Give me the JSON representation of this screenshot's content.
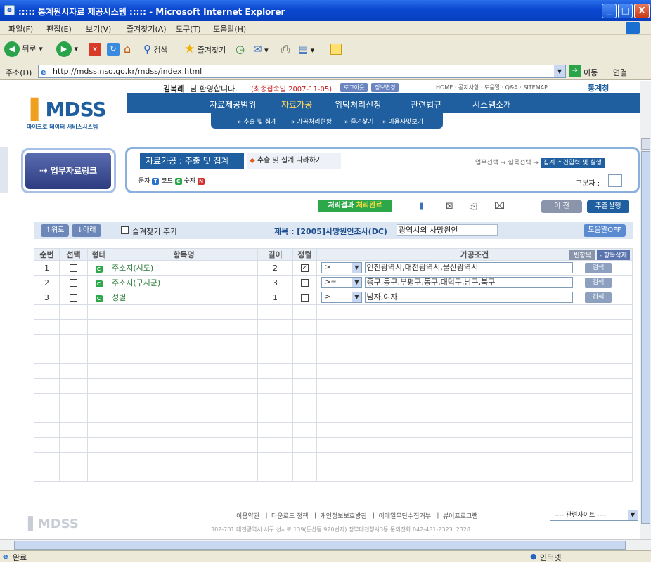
{
  "window": {
    "title": "::::: 통계원시자료 제공시스템 ::::: - Microsoft Internet Explorer",
    "min": "_",
    "max": "□",
    "close": "X"
  },
  "menu": [
    "파일(F)",
    "편집(E)",
    "보기(V)",
    "즐겨찾기(A)",
    "도구(T)",
    "도움말(H)"
  ],
  "toolbar": {
    "back": "뒤로",
    "search": "검색",
    "favorites": "즐겨찾기"
  },
  "address": {
    "label": "주소(D)",
    "url": "http://mdss.nso.go.kr/mdss/index.html",
    "go": "이동",
    "links": "연결"
  },
  "header": {
    "welcome_name": "김복례",
    "welcome_suffix": "님 환영합니다.",
    "last_login": "(최종접속일 2007-11-05)",
    "logout": "로그아웃",
    "info_change": "정보변경",
    "toplinks": "HOME · 공지사항 · 도움말 · Q&A · SITEMAP",
    "agency": "통계청",
    "logo": "MDSS",
    "logo_sub": "마이크로 데이터 서비스시스템"
  },
  "nav": {
    "items": [
      "자료제공범위",
      "자료가공",
      "위탁처리신청",
      "관련법규",
      "시스템소개"
    ],
    "sub": [
      "» 추출 및 집계",
      "» 가공처리현황",
      "» 즐겨찾기",
      "» 이용자맞보기"
    ]
  },
  "left": {
    "button": "업무자료링크"
  },
  "panel": {
    "title": "자료가공 : 추출 및 집계",
    "follow": "추출 및 집계 따라하기",
    "legend": {
      "text": "문자",
      "code": "코드",
      "num": "숫자"
    },
    "steps": {
      "s1": "업무선택",
      "s2": "항목선택",
      "s3": "집계 조건입력 및 실행"
    },
    "delimiter_label": "구분자 :"
  },
  "actions": {
    "result_label": "처리결과",
    "result_status": "처리완료",
    "prev": "이 전",
    "run": "추출실행"
  },
  "bar": {
    "up": "↑위로",
    "down": "↓아래",
    "fav_add": "즐겨찾기 추가",
    "subject_label": "제목 : [2005]사망원인조사(DC)",
    "subject_value": "광역시의 사망원인",
    "help_off": "도움말OFF"
  },
  "table": {
    "headers": [
      "순번",
      "선택",
      "형태",
      "항목명",
      "길이",
      "정렬",
      "가공조건"
    ],
    "blank_btn": "빈항목",
    "del_btn": "- 항목삭제",
    "search_btn": "검색",
    "rows": [
      {
        "no": "1",
        "name": "주소지(시도)",
        "len": "2",
        "sorted": true,
        "op": ">",
        "cond": "인천광역시,대전광역시,울산광역시"
      },
      {
        "no": "2",
        "name": "주소지(구시군)",
        "len": "3",
        "sorted": false,
        "op": ">=",
        "cond": "중구,동구,부평구,동구,대덕구,남구,북구"
      },
      {
        "no": "3",
        "name": "성별",
        "len": "1",
        "sorted": false,
        "op": ">",
        "cond": "남자,여자"
      }
    ]
  },
  "footer": {
    "links": "이용약관  ㅣ 다운로드 정책  ㅣ 개인정보보호방침  ㅣ 이메일무단수집거부  ㅣ 뷰어프로그램",
    "related": "---- 관련사이트 ----",
    "address": "302-701 대전광역시 서구 선사로 139(둔산동 920번지) 정부대전청사3동  문의전화 042-481-2323, 2328",
    "logo": "MDSS"
  },
  "status": {
    "left": "완료",
    "zone": "인터넷"
  },
  "colors": {
    "titlebar": "#0a48d0",
    "nav": "#1f5f9f",
    "panel_border": "#8ab0dc",
    "green": "#2ca84a"
  }
}
